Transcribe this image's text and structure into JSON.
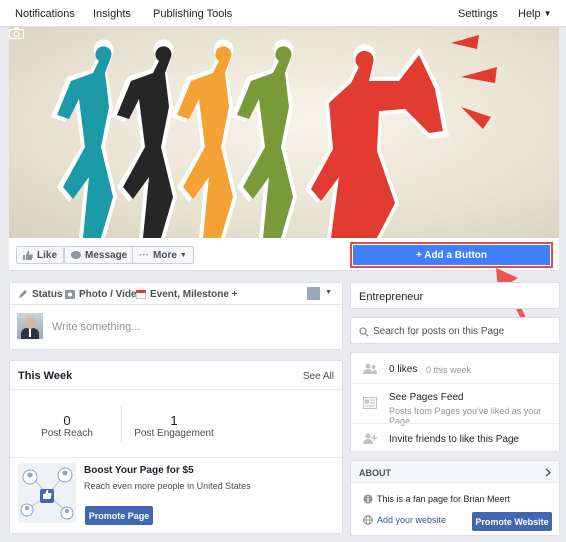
{
  "topnav": {
    "notifications": "Notifications",
    "insights": "Insights",
    "publishing_tools": "Publishing Tools",
    "settings": "Settings",
    "help": "Help"
  },
  "actions": {
    "like": "Like",
    "message": "Message",
    "more": "More",
    "add_button": "+ Add a Button"
  },
  "composer": {
    "tab_status": "Status",
    "tab_photo": "Photo / Video",
    "tab_event": "Event, Milestone +",
    "placeholder": "Write something..."
  },
  "this_week": {
    "title": "This Week",
    "see_all": "See All",
    "stats": [
      {
        "value": "0",
        "label": "Post Reach"
      },
      {
        "value": "1",
        "label": "Post Engagement"
      }
    ],
    "boost_title": "Boost Your Page for $5",
    "boost_desc": "Reach even more people in United States",
    "promote_page": "Promote Page"
  },
  "right": {
    "category": "Entrepreneur",
    "search_placeholder": "Search for posts on this Page",
    "likes": "0 likes",
    "likes_week": "0 this week",
    "pages_feed_title": "See Pages Feed",
    "pages_feed_desc": "Posts from Pages you've liked as your Page",
    "invite": "Invite friends to like this Page",
    "about_title": "ABOUT",
    "about_desc": "This is a fan page for Brian Meert",
    "add_website": "Add your website",
    "promote_website": "Promote Website"
  },
  "colors": {
    "accent": "#4080ff",
    "highlight": "#e84a4a",
    "promote": "#4267b2"
  }
}
